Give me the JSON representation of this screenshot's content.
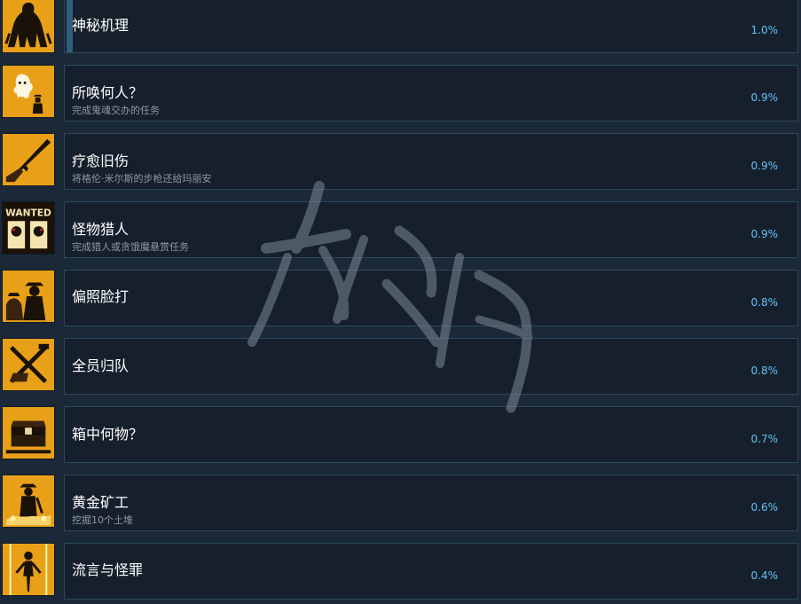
{
  "achievements": [
    {
      "title": "神秘机理",
      "desc": "",
      "percent": "1.0%",
      "icon": "shadow-figure-icon",
      "partial": true
    },
    {
      "title": "所唤何人？",
      "desc": "完成鬼魂交办的任务",
      "percent": "0.9%",
      "icon": "ghost-cowboy-icon"
    },
    {
      "title": "疗愈旧伤",
      "desc": "将格伦·米尔斯的步枪还给玛丽安",
      "percent": "0.9%",
      "icon": "rifle-icon"
    },
    {
      "title": "怪物猎人",
      "desc": "完成猎人或贪饿魔悬赏任务",
      "percent": "0.9%",
      "icon": "wanted-poster-icon",
      "icon_text": "WANTED"
    },
    {
      "title": "偏照脸打",
      "desc": "",
      "percent": "0.8%",
      "icon": "cowboys-icon"
    },
    {
      "title": "全员归队",
      "desc": "",
      "percent": "0.8%",
      "icon": "crossed-tools-icon"
    },
    {
      "title": "箱中何物？",
      "desc": "",
      "percent": "0.7%",
      "icon": "treasure-chest-icon"
    },
    {
      "title": "黄金矿工",
      "desc": "挖掘10个土堆",
      "percent": "0.6%",
      "icon": "gold-miner-icon"
    },
    {
      "title": "流言与怪罪",
      "desc": "",
      "percent": "0.4%",
      "icon": "glowing-figure-icon"
    }
  ],
  "colors": {
    "background": "#1b2838",
    "panel": "#16202d",
    "border": "#2a4a5c",
    "percent": "#66c0f4",
    "icon_bg": "#e9a019"
  }
}
